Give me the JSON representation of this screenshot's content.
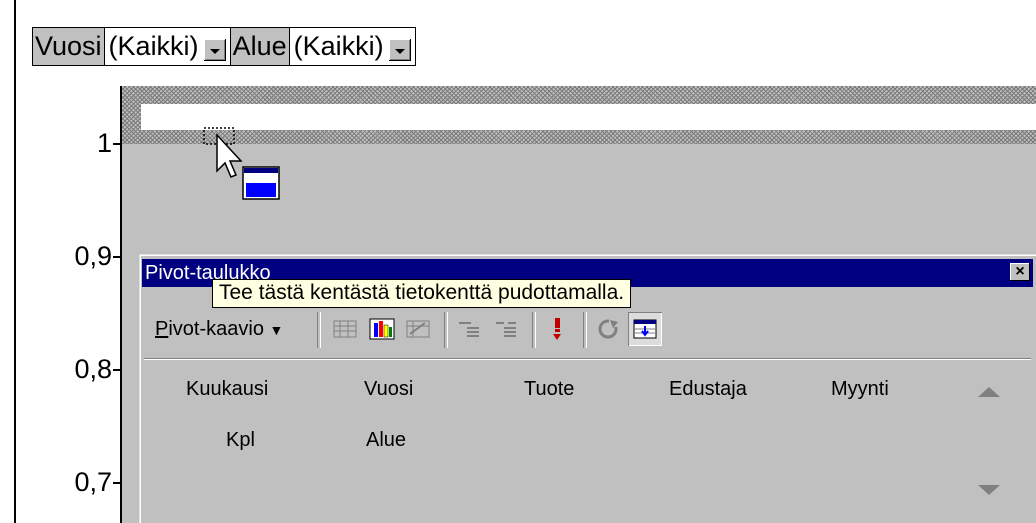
{
  "page_fields": [
    {
      "label": "Vuosi",
      "value": "(Kaikki)"
    },
    {
      "label": "Alue",
      "value": "(Kaikki)"
    }
  ],
  "y_axis": {
    "ticks": [
      "1",
      "0,9",
      "0,8",
      "0,7"
    ]
  },
  "pivot_toolbar": {
    "title": "Pivot-taulukko",
    "menu_label": "Pivot-kaavio",
    "menu_mnemonic": "P",
    "menu_rest": "ivot-kaavio",
    "tooltip": "Tee tästä kentästä tietokenttä pudottamalla.",
    "fields_row1": [
      "Kuukausi",
      "Vuosi",
      "Tuote",
      "Edustaja",
      "Myynti"
    ],
    "fields_row2": [
      "Kpl",
      "Alue"
    ],
    "colors": {
      "title_bar": "#000080",
      "face": "#c0c0c0",
      "tooltip_bg": "#ffffe1"
    }
  }
}
